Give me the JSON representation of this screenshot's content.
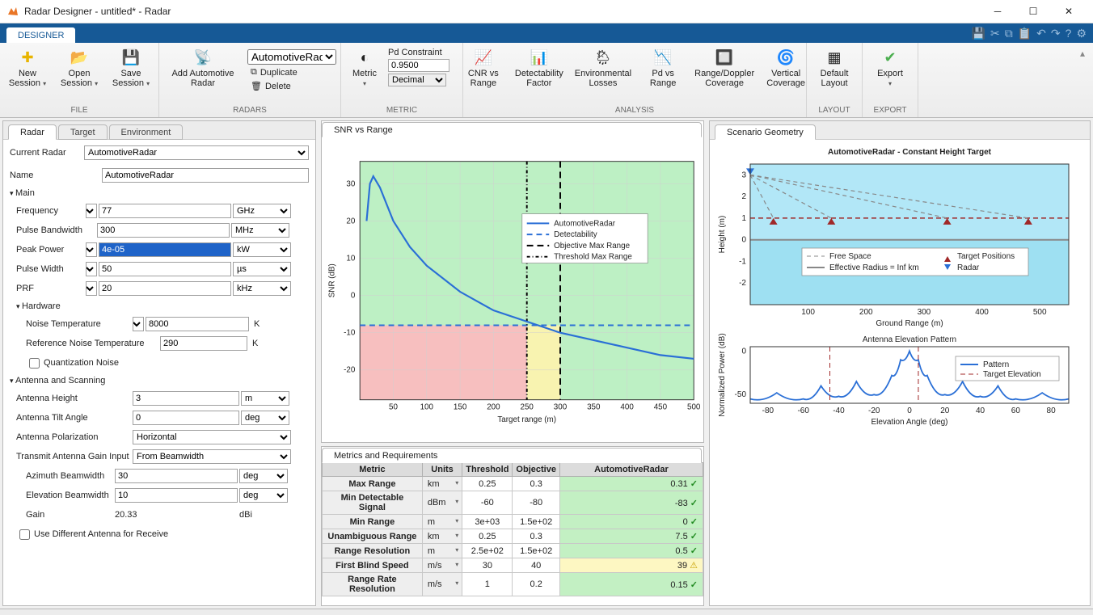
{
  "window": {
    "title": "Radar Designer - untitled* - Radar"
  },
  "ribbon": {
    "tab": "DESIGNER",
    "groups": {
      "file": {
        "label": "FILE",
        "new": "New\nSession",
        "open": "Open\nSession",
        "save": "Save\nSession"
      },
      "radars": {
        "label": "RADARS",
        "add": "Add Automotive\nRadar",
        "sel": "AutomotiveRadar",
        "dup": "Duplicate",
        "del": "Delete"
      },
      "metric": {
        "label": "METRIC",
        "metric": "Metric",
        "pd": "Pd Constraint",
        "pdval": "0.9500",
        "fmt": "Decimal"
      },
      "analysis": {
        "label": "ANALYSIS",
        "cnr": "CNR vs\nRange",
        "det": "Detectability\nFactor",
        "env": "Environmental\nLosses",
        "pdvs": "Pd vs\nRange",
        "rdc": "Range/Doppler\nCoverage",
        "vc": "Vertical\nCoverage"
      },
      "layout": {
        "label": "LAYOUT",
        "def": "Default\nLayout"
      },
      "export": {
        "label": "EXPORT",
        "exp": "Export"
      }
    }
  },
  "tabs": {
    "radar": "Radar",
    "target": "Target",
    "env": "Environment"
  },
  "left": {
    "curradar_lbl": "Current Radar",
    "curradar": "AutomotiveRadar",
    "name_lbl": "Name",
    "name": "AutomotiveRadar",
    "main": "Main",
    "freq_lbl": "Frequency",
    "freq": "77",
    "freq_u": "GHz",
    "pbw_lbl": "Pulse Bandwidth",
    "pbw": "300",
    "pbw_u": "MHz",
    "pp_lbl": "Peak Power",
    "pp": "4e-05",
    "pp_u": "kW",
    "pw_lbl": "Pulse Width",
    "pw": "50",
    "pw_u": "µs",
    "prf_lbl": "PRF",
    "prf": "20",
    "prf_u": "kHz",
    "hw": "Hardware",
    "nt_lbl": "Noise Temperature",
    "nt": "8000",
    "nt_u": "K",
    "rnt_lbl": "Reference Noise Temperature",
    "rnt": "290",
    "rnt_u": "K",
    "qn": "Quantization Noise",
    "ant": "Antenna and Scanning",
    "ah_lbl": "Antenna Height",
    "ah": "3",
    "ah_u": "m",
    "ata_lbl": "Antenna Tilt Angle",
    "ata": "0",
    "ata_u": "deg",
    "ap_lbl": "Antenna Polarization",
    "ap": "Horizontal",
    "tagi_lbl": "Transmit Antenna Gain Input",
    "tagi": "From Beamwidth",
    "abw_lbl": "Azimuth Beamwidth",
    "abw": "30",
    "abw_u": "deg",
    "ebw_lbl": "Elevation Beamwidth",
    "ebw": "10",
    "ebw_u": "deg",
    "gain_lbl": "Gain",
    "gain": "20.33",
    "gain_u": "dBi",
    "udar": "Use Different Antenna for Receive"
  },
  "snr": {
    "tab": "SNR vs Range",
    "xlabel": "Target range (m)",
    "ylabel": "SNR (dB)",
    "legend": [
      "AutomotiveRadar",
      "Detectability",
      "Objective Max Range",
      "Threshold Max Range"
    ]
  },
  "scen": {
    "tab": "Scenario Geometry",
    "title1": "AutomotiveRadar - Constant Height Target",
    "x1": "Ground Range (m)",
    "y1": "Height (m)",
    "leg1": [
      "Free Space",
      "Effective Radius = Inf km",
      "Target Positions",
      "Radar"
    ],
    "title2": "Antenna Elevation Pattern",
    "x2": "Elevation Angle (deg)",
    "y2": "Normalized Power (dB)",
    "leg2": [
      "Pattern",
      "Target Elevation"
    ]
  },
  "metrics": {
    "tab": "Metrics and Requirements",
    "hdr": [
      "Metric",
      "Units",
      "Threshold",
      "Objective",
      "AutomotiveRadar"
    ],
    "rows": [
      {
        "m": "Max Range",
        "u": "km",
        "t": "0.25",
        "o": "0.3",
        "v": "0.31",
        "s": "pass"
      },
      {
        "m": "Min Detectable Signal",
        "u": "dBm",
        "t": "-60",
        "o": "-80",
        "v": "-83",
        "s": "pass"
      },
      {
        "m": "Min Range",
        "u": "m",
        "t": "3e+03",
        "o": "1.5e+02",
        "v": "0",
        "s": "pass"
      },
      {
        "m": "Unambiguous Range",
        "u": "km",
        "t": "0.25",
        "o": "0.3",
        "v": "7.5",
        "s": "pass"
      },
      {
        "m": "Range Resolution",
        "u": "m",
        "t": "2.5e+02",
        "o": "1.5e+02",
        "v": "0.5",
        "s": "pass"
      },
      {
        "m": "First Blind Speed",
        "u": "m/s",
        "t": "30",
        "o": "40",
        "v": "39",
        "s": "warn"
      },
      {
        "m": "Range Rate Resolution",
        "u": "m/s",
        "t": "1",
        "o": "0.2",
        "v": "0.15",
        "s": "pass"
      }
    ]
  },
  "chart_data": [
    {
      "type": "line",
      "title": "SNR vs Range",
      "xlabel": "Target range (m)",
      "ylabel": "SNR (dB)",
      "xlim": [
        0,
        500
      ],
      "ylim": [
        -28,
        36
      ],
      "regions": {
        "detect_threshold": -8,
        "objective_x": 300,
        "threshold_x": 250
      },
      "series": [
        {
          "name": "AutomotiveRadar",
          "x": [
            10,
            15,
            20,
            30,
            50,
            75,
            100,
            150,
            200,
            250,
            300,
            350,
            400,
            450,
            500
          ],
          "y": [
            20,
            30,
            32,
            29,
            20,
            13,
            8,
            1,
            -4,
            -7,
            -10,
            -12,
            -14,
            -16,
            -17
          ]
        }
      ]
    },
    {
      "type": "line",
      "title": "AutomotiveRadar - Constant Height Target",
      "xlabel": "Ground Range (m)",
      "ylabel": "Height (m)",
      "xlim": [
        0,
        550
      ],
      "ylim": [
        -3,
        3.5
      ],
      "targets_y": 1,
      "radar": {
        "x": 0,
        "y": 3
      },
      "target_x": [
        40,
        140,
        340,
        480
      ]
    },
    {
      "type": "line",
      "title": "Antenna Elevation Pattern",
      "xlabel": "Elevation Angle (deg)",
      "ylabel": "Normalized Power (dB)",
      "xlim": [
        -90,
        90
      ],
      "ylim": [
        -60,
        5
      ],
      "series": [
        {
          "name": "Pattern",
          "x": [
            -90,
            -75,
            -60,
            -50,
            -40,
            -30,
            -20,
            -10,
            -5,
            0,
            5,
            10,
            20,
            30,
            40,
            50,
            60,
            75,
            90
          ],
          "y": [
            -55,
            -48,
            -55,
            -40,
            -52,
            -35,
            -50,
            -28,
            -10,
            0,
            -10,
            -28,
            -50,
            -35,
            -52,
            -40,
            -55,
            -48,
            -55
          ]
        }
      ],
      "target_elev_x": [
        -45,
        5
      ]
    }
  ]
}
